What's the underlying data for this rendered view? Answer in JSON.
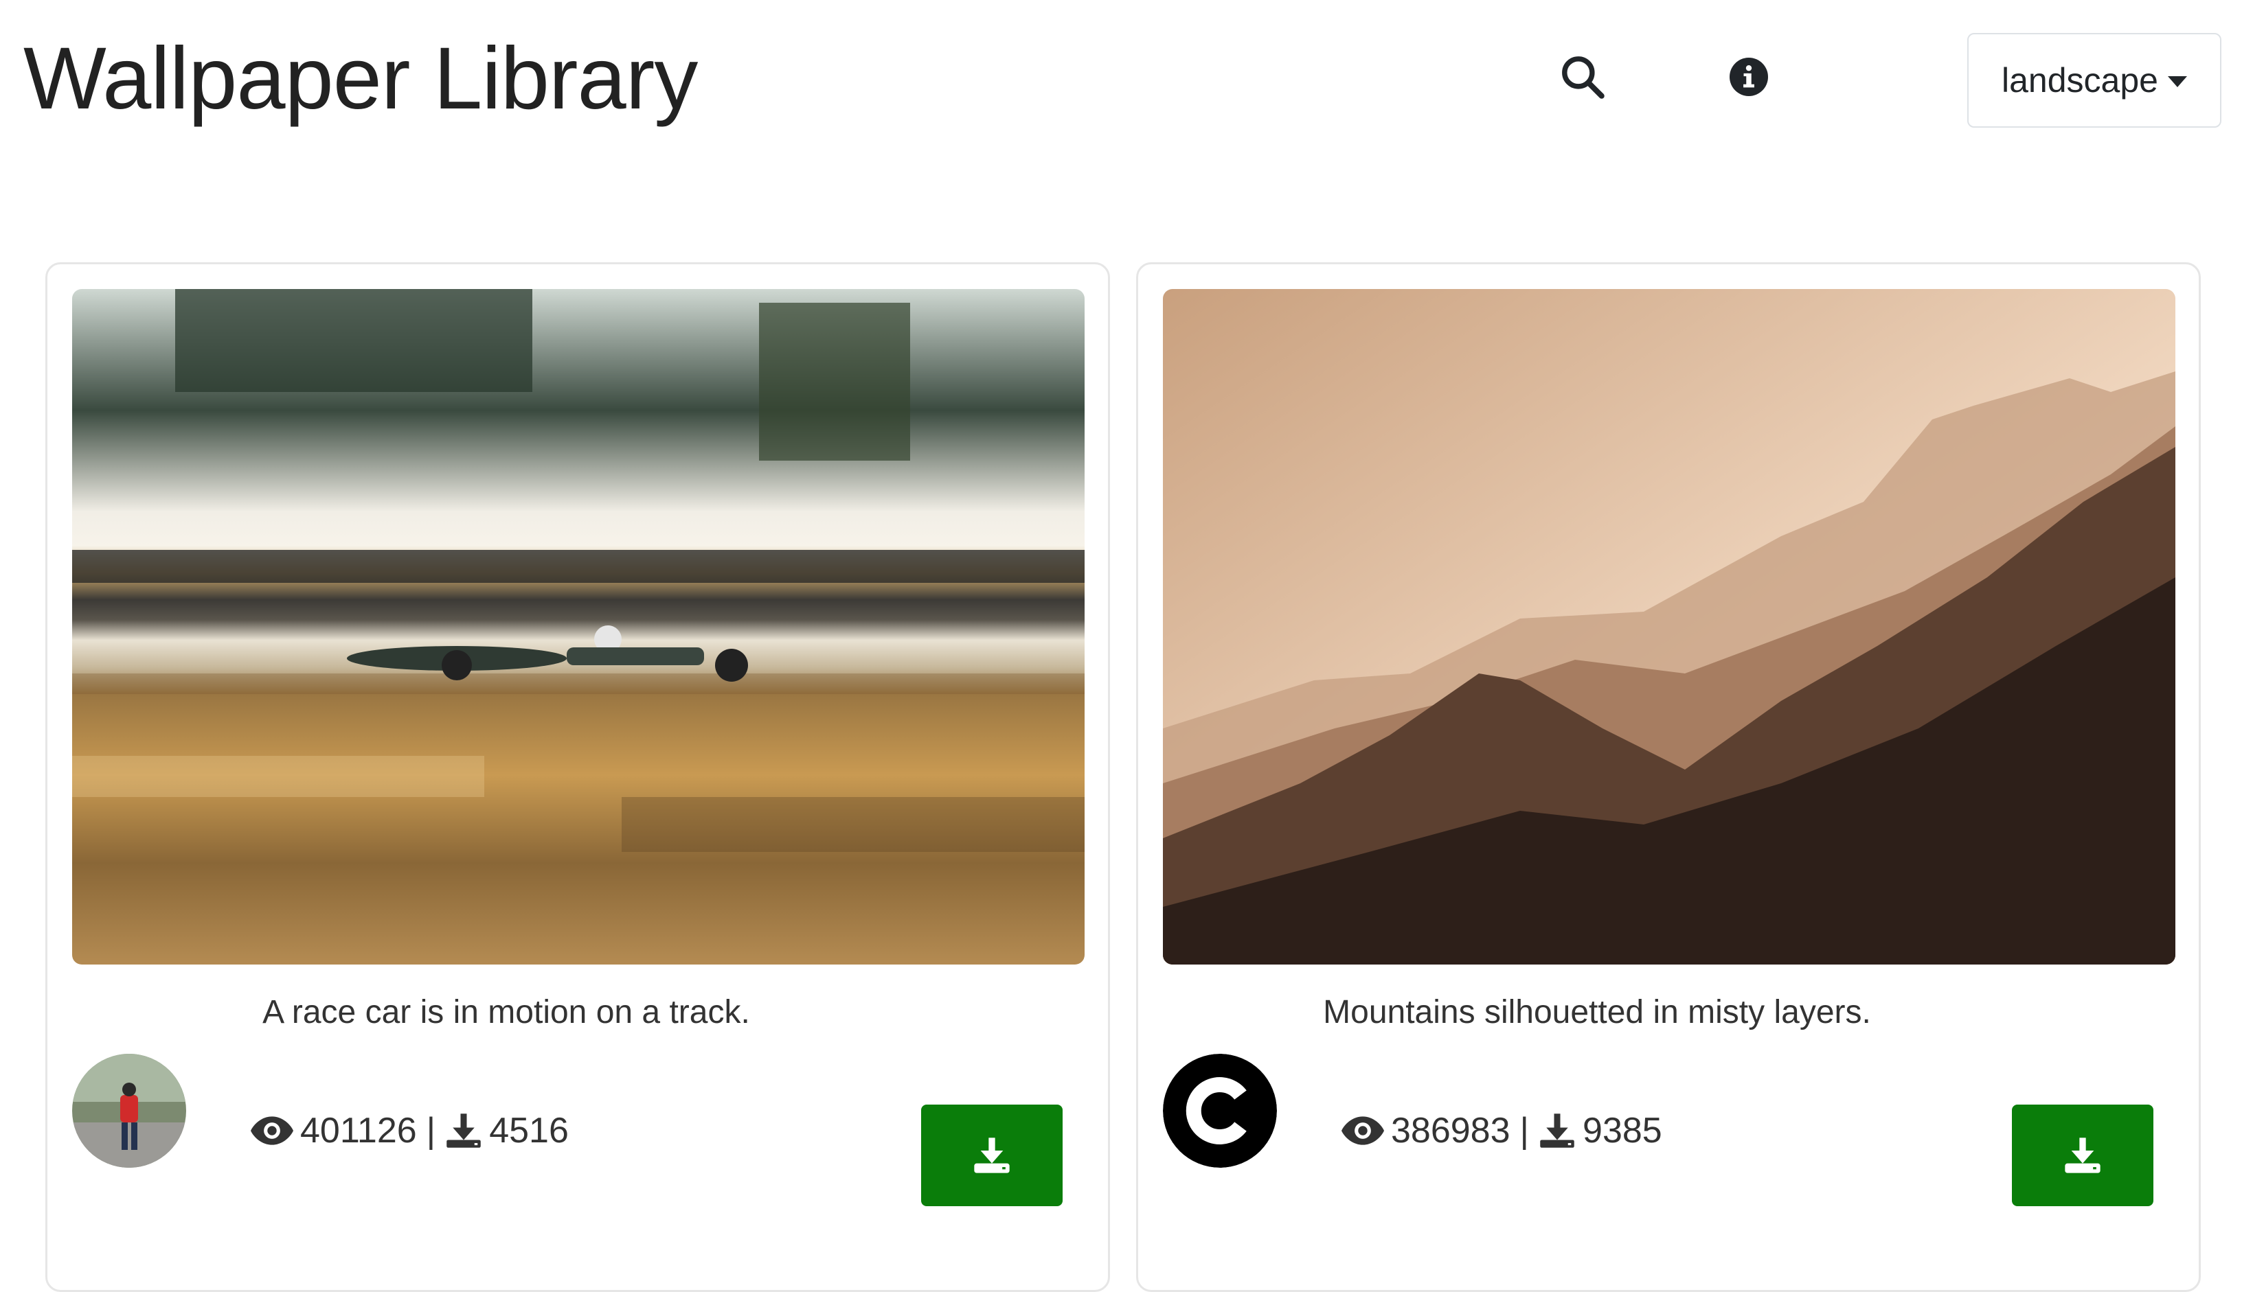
{
  "header": {
    "title": "Wallpaper Library",
    "search_icon": "search-icon",
    "info_icon": "info-icon",
    "orientation_select": {
      "value": "landscape"
    }
  },
  "cards": [
    {
      "image": "race car motion blur photo",
      "caption": "A race car is in motion on a track.",
      "avatar": "user photo avatar",
      "views": "401126",
      "separator": "|",
      "downloads": "4516",
      "download_icon": "download-icon"
    },
    {
      "image": "misty mountain silhouettes photo",
      "caption": "Mountains silhouetted in misty layers.",
      "avatar": "black C logo avatar",
      "views": "386983",
      "separator": "|",
      "downloads": "9385",
      "download_icon": "download-icon"
    }
  ],
  "colors": {
    "download_button": "#0a7d0a",
    "card_border": "#e6e6e6",
    "text": "#333333"
  }
}
